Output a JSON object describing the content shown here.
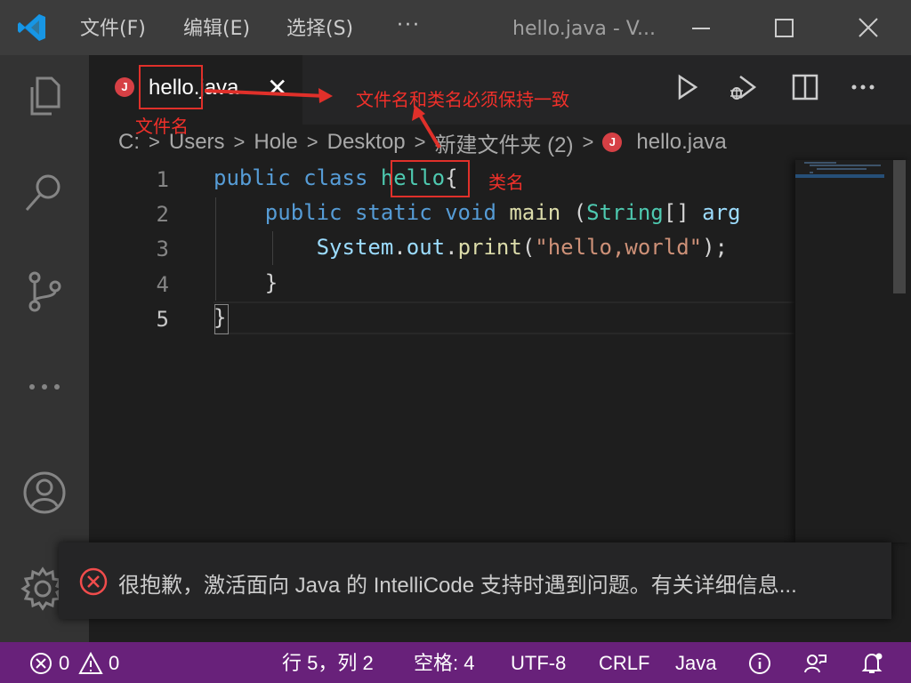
{
  "titlebar": {
    "menus": [
      "文件(F)",
      "编辑(E)",
      "选择(S)"
    ],
    "more": "···",
    "window_title": "hello.java - V..."
  },
  "tab": {
    "badge": "J",
    "label": "hello.java",
    "close": "✕"
  },
  "breadcrumb": {
    "parts": [
      "C:",
      "Users",
      "Hole",
      "Desktop",
      "新建文件夹 (2)"
    ],
    "separator": ">",
    "file_badge": "J",
    "file": "hello.java"
  },
  "editor": {
    "line_numbers": [
      "1",
      "2",
      "3",
      "4",
      "5"
    ],
    "active_line": "5",
    "lines": [
      [
        {
          "t": "kw",
          "v": "public"
        },
        {
          "t": "plain",
          "v": " "
        },
        {
          "t": "kw",
          "v": "class"
        },
        {
          "t": "plain",
          "v": " "
        },
        {
          "t": "cls",
          "v": "hello"
        },
        {
          "t": "plain",
          "v": "{"
        }
      ],
      [
        {
          "t": "plain",
          "v": "    "
        },
        {
          "t": "kw",
          "v": "public"
        },
        {
          "t": "plain",
          "v": " "
        },
        {
          "t": "kw",
          "v": "static"
        },
        {
          "t": "plain",
          "v": " "
        },
        {
          "t": "kw",
          "v": "void"
        },
        {
          "t": "plain",
          "v": " "
        },
        {
          "t": "fn",
          "v": "main"
        },
        {
          "t": "plain",
          "v": " ("
        },
        {
          "t": "cls",
          "v": "String"
        },
        {
          "t": "plain",
          "v": "[] "
        },
        {
          "t": "var",
          "v": "arg"
        }
      ],
      [
        {
          "t": "plain",
          "v": "        "
        },
        {
          "t": "var",
          "v": "System"
        },
        {
          "t": "plain",
          "v": "."
        },
        {
          "t": "var",
          "v": "out"
        },
        {
          "t": "plain",
          "v": "."
        },
        {
          "t": "fn",
          "v": "print"
        },
        {
          "t": "plain",
          "v": "("
        },
        {
          "t": "str",
          "v": "\"hello,world\""
        },
        {
          "t": "plain",
          "v": ");"
        }
      ],
      [
        {
          "t": "plain",
          "v": "    }"
        }
      ],
      [
        {
          "t": "plain",
          "v": "}"
        }
      ]
    ]
  },
  "annotations": {
    "filename_label": "文件名",
    "classname_label": "类名",
    "rule_label": "文件名和类名必须保持一致"
  },
  "notification": {
    "message": "很抱歉，激活面向 Java 的 IntelliCode 支持时遇到问题。有关详细信息..."
  },
  "statusbar": {
    "errors": "0",
    "warnings": "0",
    "position": "行 5，列 2",
    "spaces": "空格: 4",
    "encoding": "UTF-8",
    "eol": "CRLF",
    "language": "Java"
  },
  "colors": {
    "statusbar": "#68217a",
    "annotation": "#e0302a",
    "java_badge": "#d64045"
  }
}
